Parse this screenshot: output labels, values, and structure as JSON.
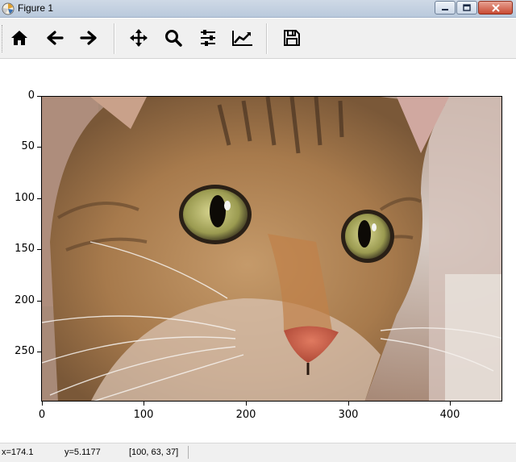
{
  "window": {
    "title": "Figure 1"
  },
  "toolbar": {
    "buttons": [
      {
        "name": "home-icon",
        "label": "Home"
      },
      {
        "name": "back-icon",
        "label": "Back"
      },
      {
        "name": "forward-icon",
        "label": "Forward"
      },
      {
        "name": "pan-icon",
        "label": "Pan"
      },
      {
        "name": "zoom-icon",
        "label": "Zoom"
      },
      {
        "name": "subplots-icon",
        "label": "Subplots"
      },
      {
        "name": "customize-icon",
        "label": "Customize"
      },
      {
        "name": "save-icon",
        "label": "Save"
      }
    ]
  },
  "axes": {
    "image": "cat photo",
    "y_ticks": [
      "0",
      "50",
      "100",
      "150",
      "200",
      "250"
    ],
    "x_ticks": [
      "0",
      "100",
      "200",
      "300",
      "400"
    ]
  },
  "status": {
    "x": "x=174.1",
    "y": "y=5.1177",
    "rgb": "[100, 63, 37]"
  },
  "colors": {
    "titlebar": "#b9c9dc",
    "toolbar": "#f0f0f0"
  }
}
